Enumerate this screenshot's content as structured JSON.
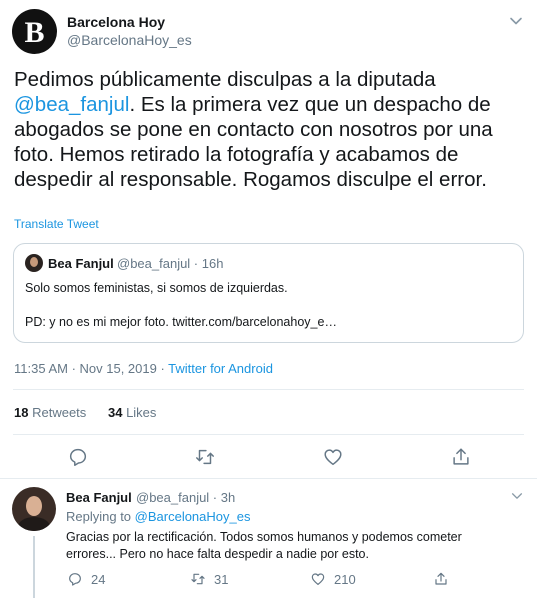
{
  "account": {
    "name": "Barcelona Hoy",
    "handle": "@BarcelonaHoy_es",
    "avatar_letter": "B"
  },
  "tweet": {
    "text_before": "Pedimos públicamente disculpas a la diputada ",
    "mention": "@bea_fanjul",
    "text_after": ". Es la primera vez que un despacho de abogados se pone en contacto con nosotros por una foto. Hemos retirado la fotografía y acabamos de despedir al responsable. Rogamos disculpe el error.",
    "translate_label": "Translate Tweet",
    "time": "11:35 AM · Nov 15, 2019 · ",
    "source": "Twitter for Android",
    "retweets_count": "18",
    "retweets_label": "Retweets",
    "likes_count": "34",
    "likes_label": "Likes"
  },
  "quoted": {
    "name": "Bea Fanjul",
    "handle_time": "@bea_fanjul · 16h",
    "line1": "Solo somos feministas, si somos de izquierdas.",
    "line2": "PD: y no es mi mejor foto. twitter.com/barcelonahoy_e…"
  },
  "reply": {
    "name": "Bea Fanjul",
    "handle_time": "@bea_fanjul · 3h",
    "replying_prefix": "Replying to ",
    "replying_to": "@BarcelonaHoy_es",
    "text_line1": "Gracias por la rectificación. Todos somos humanos y podemos cometer",
    "text_line2": "errores... Pero no hace falta despedir a nadie por esto.",
    "reply_count": "24",
    "retweet_count": "31",
    "like_count": "210"
  },
  "icons": [
    "chevron-down-icon",
    "reply-icon",
    "retweet-icon",
    "like-icon",
    "share-icon"
  ],
  "colors": {
    "link": "#1b95e0",
    "muted": "#657786",
    "text": "#14171a",
    "border": "#ccd6dd"
  }
}
